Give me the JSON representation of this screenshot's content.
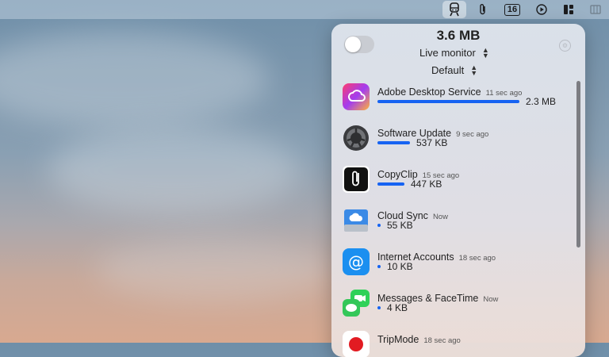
{
  "menubar": {
    "badge": "16",
    "icons": [
      "tripmode-train-icon",
      "paperclip-icon",
      "calendar-badge-icon",
      "play-circle-icon",
      "window-layout-icon",
      "grid-icon"
    ]
  },
  "panel": {
    "total": "3.6 MB",
    "mode": "Live monitor",
    "profile": "Default",
    "apps": [
      {
        "name": "Adobe Desktop Service",
        "ago": "11 sec ago",
        "size": "2.3 MB",
        "fraction": 1.0,
        "icon": "adobe-cc-icon"
      },
      {
        "name": "Software Update",
        "ago": "9 sec ago",
        "size": "537 KB",
        "fraction": 0.23,
        "icon": "software-update-icon"
      },
      {
        "name": "CopyClip",
        "ago": "15 sec ago",
        "size": "447 KB",
        "fraction": 0.19,
        "icon": "copyclip-icon"
      },
      {
        "name": "Cloud Sync",
        "ago": "Now",
        "size": "55 KB",
        "fraction": 0.02,
        "icon": "cloud-sync-icon"
      },
      {
        "name": "Internet Accounts",
        "ago": "18 sec ago",
        "size": "10 KB",
        "fraction": 0.01,
        "icon": "internet-accounts-icon"
      },
      {
        "name": "Messages & FaceTime",
        "ago": "Now",
        "size": "4 KB",
        "fraction": 0.01,
        "icon": "messages-facetime-icon"
      },
      {
        "name": "TripMode",
        "ago": "18 sec ago",
        "size": "",
        "fraction": 0,
        "icon": "tripmode-icon"
      }
    ]
  }
}
